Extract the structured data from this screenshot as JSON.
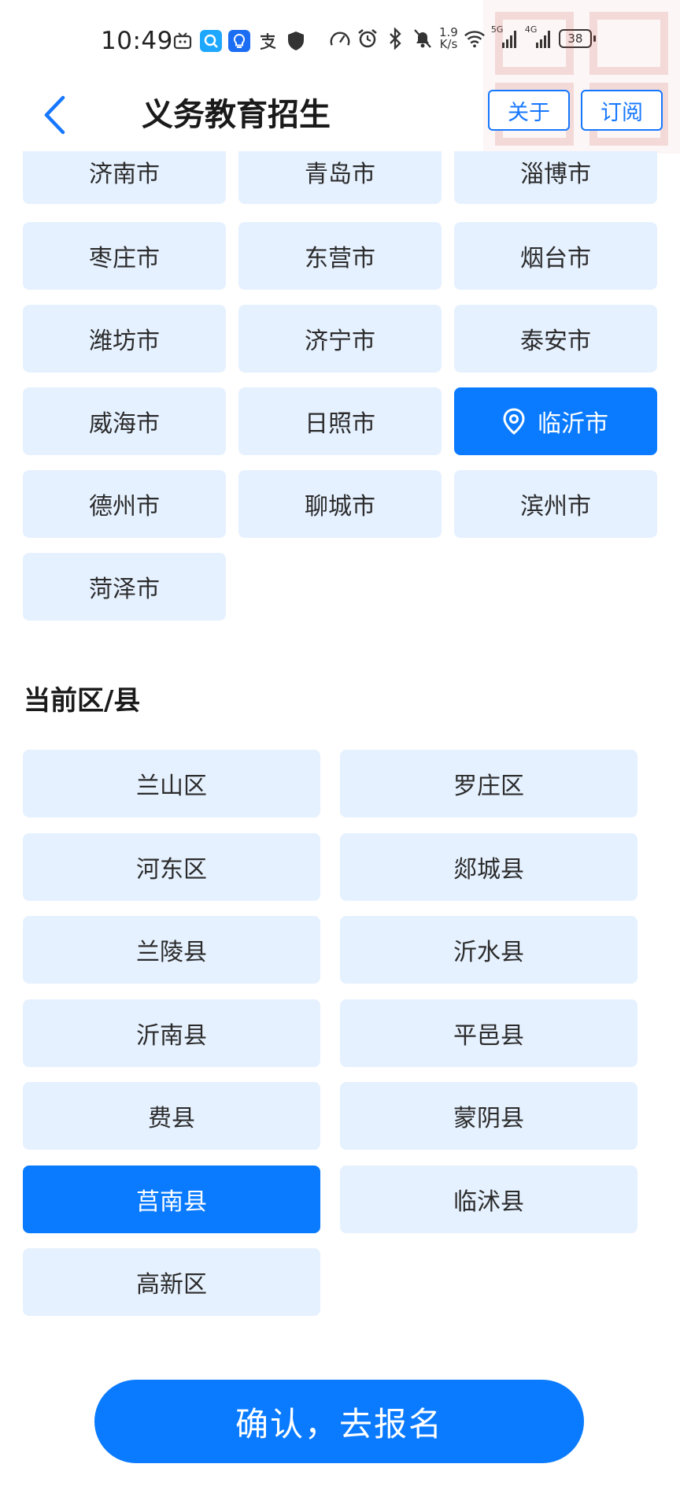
{
  "status_bar": {
    "time": "10:49",
    "network_speed_value": "1.9",
    "network_speed_unit": "K/s",
    "battery": "38",
    "signal1_label": "5G",
    "signal2_label": "4G"
  },
  "header": {
    "title": "义务教育招生",
    "about_label": "关于",
    "subscribe_label": "订阅"
  },
  "cities": [
    {
      "label": "济南市",
      "selected": false
    },
    {
      "label": "青岛市",
      "selected": false
    },
    {
      "label": "淄博市",
      "selected": false
    },
    {
      "label": "枣庄市",
      "selected": false
    },
    {
      "label": "东营市",
      "selected": false
    },
    {
      "label": "烟台市",
      "selected": false
    },
    {
      "label": "潍坊市",
      "selected": false
    },
    {
      "label": "济宁市",
      "selected": false
    },
    {
      "label": "泰安市",
      "selected": false
    },
    {
      "label": "威海市",
      "selected": false
    },
    {
      "label": "日照市",
      "selected": false
    },
    {
      "label": "临沂市",
      "selected": true
    },
    {
      "label": "德州市",
      "selected": false
    },
    {
      "label": "聊城市",
      "selected": false
    },
    {
      "label": "滨州市",
      "selected": false
    },
    {
      "label": "菏泽市",
      "selected": false
    }
  ],
  "district_section_title": "当前区/县",
  "districts": [
    {
      "label": "兰山区",
      "selected": false
    },
    {
      "label": "罗庄区",
      "selected": false
    },
    {
      "label": "河东区",
      "selected": false
    },
    {
      "label": "郯城县",
      "selected": false
    },
    {
      "label": "兰陵县",
      "selected": false
    },
    {
      "label": "沂水县",
      "selected": false
    },
    {
      "label": "沂南县",
      "selected": false
    },
    {
      "label": "平邑县",
      "selected": false
    },
    {
      "label": "费县",
      "selected": false
    },
    {
      "label": "蒙阴县",
      "selected": false
    },
    {
      "label": "莒南县",
      "selected": true
    },
    {
      "label": "临沭县",
      "selected": false
    },
    {
      "label": "高新区",
      "selected": false
    }
  ],
  "confirm_label": "确认，去报名",
  "colors": {
    "accent": "#0a7bff",
    "chip_bg": "#e6f1ff",
    "header_button_border": "#1677ff"
  }
}
